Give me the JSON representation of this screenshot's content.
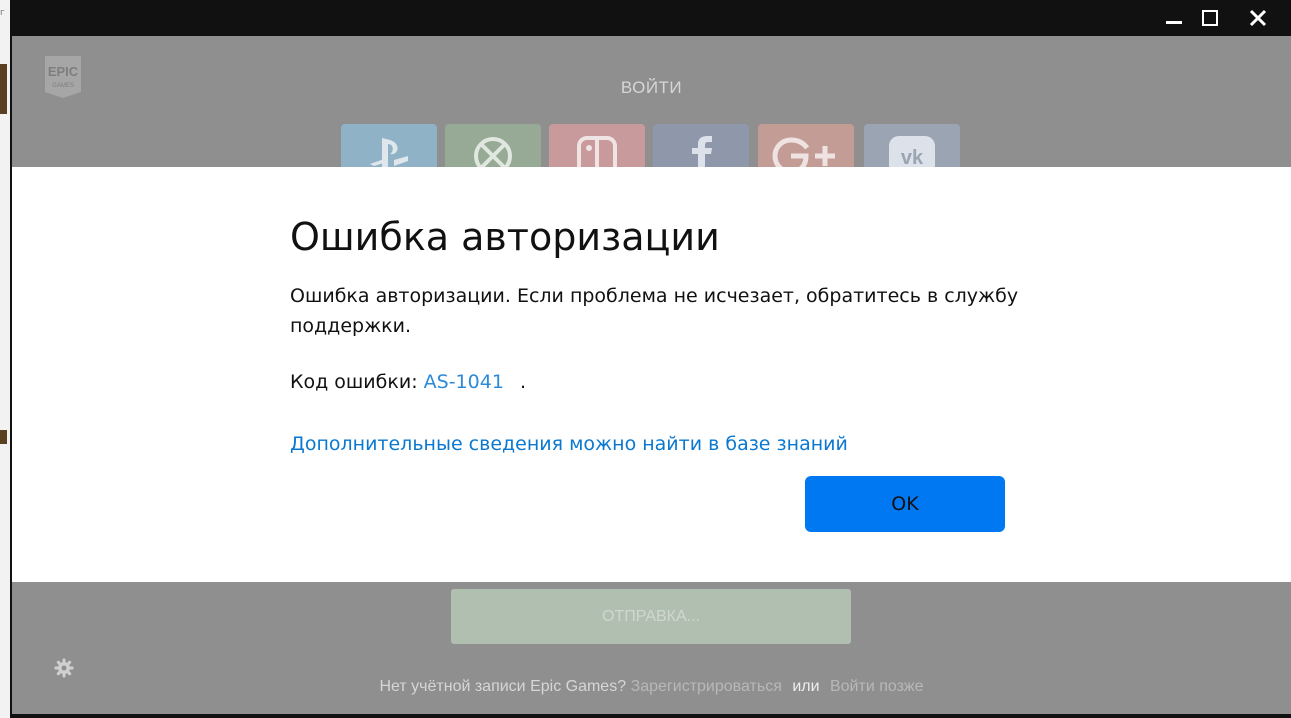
{
  "window": {
    "controls": [
      "minimize",
      "maximize",
      "close"
    ]
  },
  "brand": {
    "logo_top": "EPIC",
    "logo_bottom": "GAMES"
  },
  "login": {
    "title": "ВОЙТИ",
    "social_buttons": [
      {
        "name": "playstation",
        "color": "#2d9ad6"
      },
      {
        "name": "xbox",
        "color": "#3c8c3c"
      },
      {
        "name": "nintendo-switch",
        "color": "#e0202a"
      },
      {
        "name": "facebook",
        "color": "#3b5998"
      },
      {
        "name": "google-plus",
        "color": "#dd4b39"
      },
      {
        "name": "vk",
        "color": "#507cb3"
      }
    ],
    "submit_label": "ОТПРАВКА..."
  },
  "dialog": {
    "title": "Ошибка авторизации",
    "message": "Ошибка авторизации. Если проблема не исчезает, обратитесь в службу поддержки.",
    "error_label": "Код ошибки:",
    "error_code": "AS-1041",
    "error_suffix": ".",
    "kb_link": "Дополнительные сведения можно найти в базе знаний",
    "ok_label": "OK"
  },
  "footer": {
    "no_account": "Нет учётной записи Epic Games?",
    "register": "Зарегистрироваться",
    "or": "или",
    "later": "Войти позже"
  },
  "colors": {
    "accent": "#0078f2",
    "link": "#0a78d0"
  }
}
